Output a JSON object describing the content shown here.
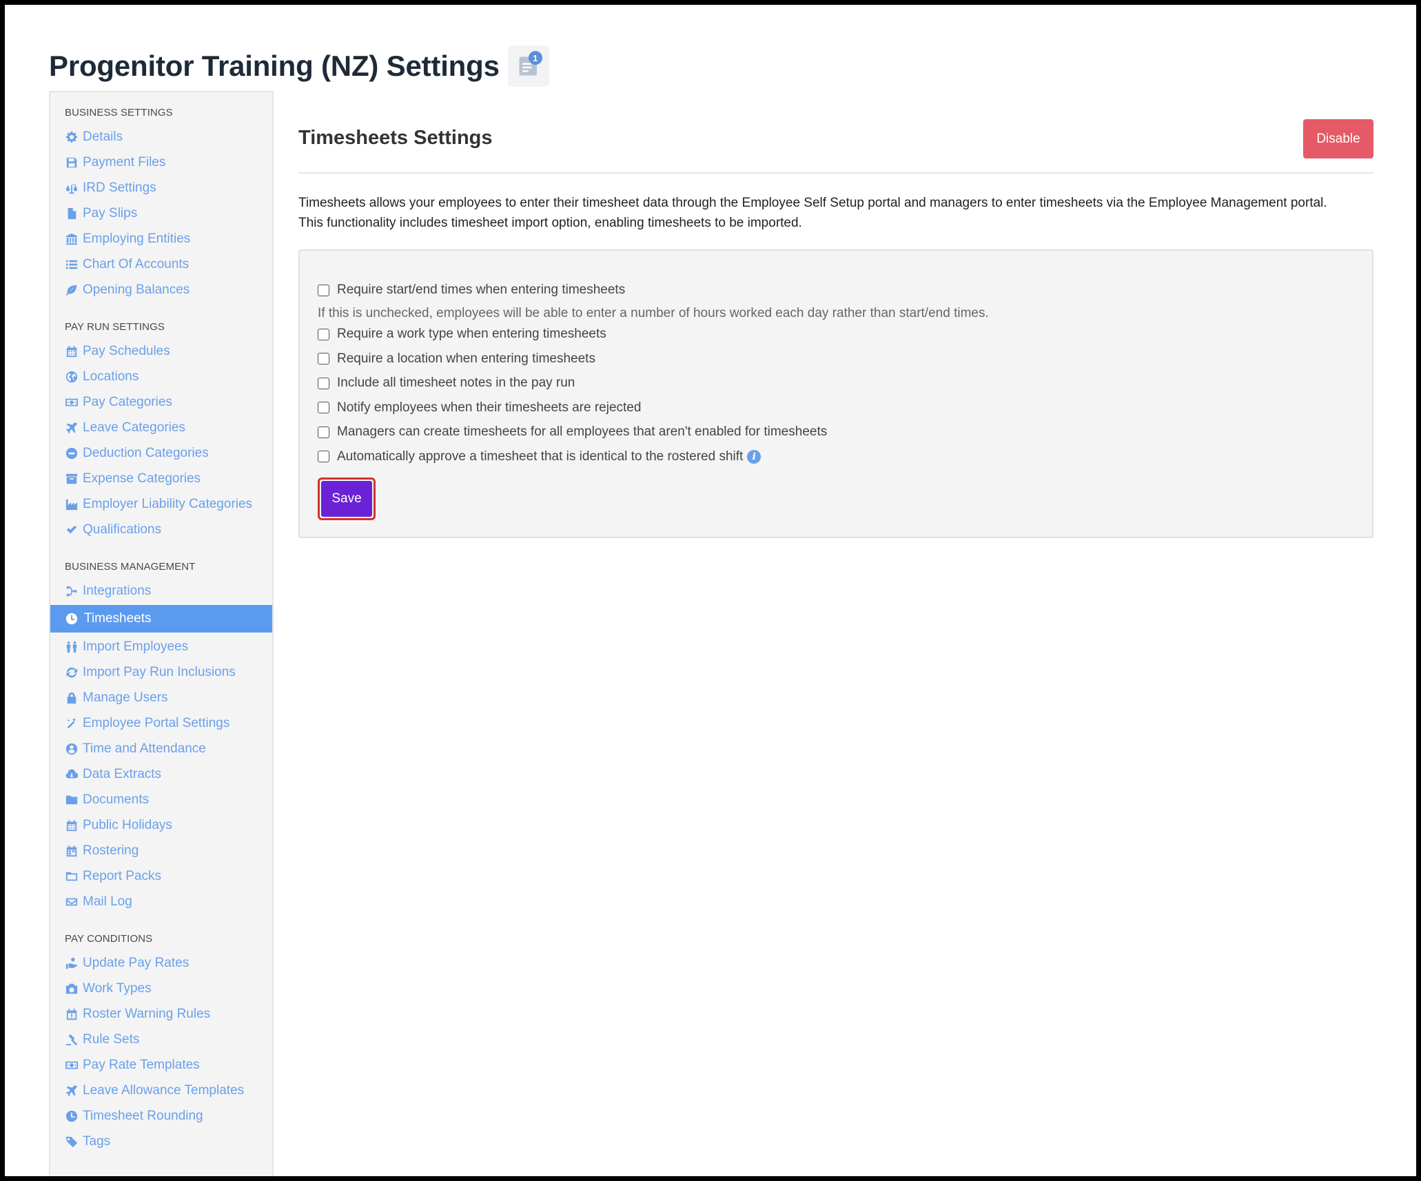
{
  "header": {
    "title": "Progenitor Training (NZ) Settings",
    "notes_badge": "1",
    "notes_icon": "notes-icon"
  },
  "sidebar": {
    "sections": [
      {
        "heading": "Business Settings",
        "items": [
          {
            "label": "Details",
            "icon": "gear-icon"
          },
          {
            "label": "Payment Files",
            "icon": "save-icon"
          },
          {
            "label": "IRD Settings",
            "icon": "scale-icon"
          },
          {
            "label": "Pay Slips",
            "icon": "file-icon"
          },
          {
            "label": "Employing Entities",
            "icon": "bank-icon"
          },
          {
            "label": "Chart Of Accounts",
            "icon": "list-icon"
          },
          {
            "label": "Opening Balances",
            "icon": "leaf-icon"
          }
        ]
      },
      {
        "heading": "Pay Run Settings",
        "items": [
          {
            "label": "Pay Schedules",
            "icon": "calendar-icon"
          },
          {
            "label": "Locations",
            "icon": "globe-icon"
          },
          {
            "label": "Pay Categories",
            "icon": "money-icon"
          },
          {
            "label": "Leave Categories",
            "icon": "plane-icon"
          },
          {
            "label": "Deduction Categories",
            "icon": "minus-circle-icon"
          },
          {
            "label": "Expense Categories",
            "icon": "archive-icon"
          },
          {
            "label": "Employer Liability Categories",
            "icon": "industry-icon"
          },
          {
            "label": "Qualifications",
            "icon": "check-icon"
          }
        ]
      },
      {
        "heading": "Business Management",
        "items": [
          {
            "label": "Integrations",
            "icon": "integration-icon"
          },
          {
            "label": "Timesheets",
            "icon": "clock-icon",
            "active": true
          },
          {
            "label": "Import Employees",
            "icon": "users-icon"
          },
          {
            "label": "Import Pay Run Inclusions",
            "icon": "refresh-icon"
          },
          {
            "label": "Manage Users",
            "icon": "lock-icon"
          },
          {
            "label": "Employee Portal Settings",
            "icon": "wand-icon"
          },
          {
            "label": "Time and Attendance",
            "icon": "user-clock-icon"
          },
          {
            "label": "Data Extracts",
            "icon": "cloud-download-icon"
          },
          {
            "label": "Documents",
            "icon": "folder-icon"
          },
          {
            "label": "Public Holidays",
            "icon": "calendar-icon"
          },
          {
            "label": "Rostering",
            "icon": "calendar-grid-icon"
          },
          {
            "label": "Report Packs",
            "icon": "folder-open-icon"
          },
          {
            "label": "Mail Log",
            "icon": "envelope-icon"
          }
        ]
      },
      {
        "heading": "Pay Conditions",
        "items": [
          {
            "label": "Update Pay Rates",
            "icon": "hand-money-icon"
          },
          {
            "label": "Work Types",
            "icon": "camera-icon"
          },
          {
            "label": "Roster Warning Rules",
            "icon": "calendar-alert-icon"
          },
          {
            "label": "Rule Sets",
            "icon": "gavel-icon"
          },
          {
            "label": "Pay Rate Templates",
            "icon": "money-icon"
          },
          {
            "label": "Leave Allowance Templates",
            "icon": "plane-icon"
          },
          {
            "label": "Timesheet Rounding",
            "icon": "clock-icon"
          },
          {
            "label": "Tags",
            "icon": "tag-icon"
          }
        ]
      }
    ]
  },
  "main": {
    "title": "Timesheets Settings",
    "disable_label": "Disable",
    "description_line1": "Timesheets allows your employees to enter their timesheet data through the Employee Self Setup portal and managers to enter timesheets via the Employee Management portal.",
    "description_line2": "This functionality includes timesheet import option, enabling timesheets to be imported.",
    "options": [
      {
        "label": "Require start/end times when entering timesheets",
        "checked": false
      },
      {
        "label": "Require a work type when entering timesheets",
        "checked": false
      },
      {
        "label": "Require a location when entering timesheets",
        "checked": false
      },
      {
        "label": "Include all timesheet notes in the pay run",
        "checked": false
      },
      {
        "label": "Notify employees when their timesheets are rejected",
        "checked": false
      },
      {
        "label": "Managers can create timesheets for all employees that aren't enabled for timesheets",
        "checked": false
      },
      {
        "label": "Automatically approve a timesheet that is identical to the rostered shift",
        "checked": false,
        "info": true
      }
    ],
    "start_end_hint": "If this is unchecked, employees will be able to enter a number of hours worked each day rather than start/end times.",
    "info_glyph": "i",
    "save_label": "Save"
  },
  "colors": {
    "accent": "#5b9bef",
    "link": "#6aa0e8",
    "danger": "#e55a66",
    "primary": "#6b22d6",
    "highlight_border": "#d0342c"
  }
}
